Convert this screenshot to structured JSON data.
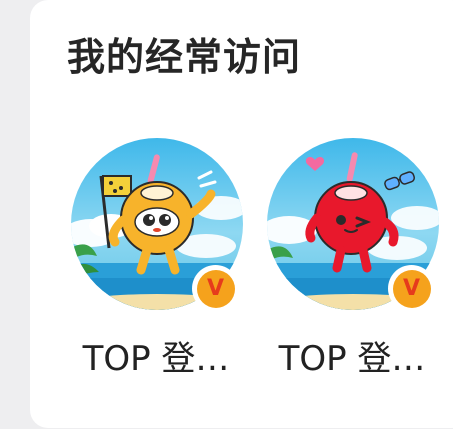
{
  "section": {
    "title": "我的经常访问"
  },
  "items": [
    {
      "name": "TOP 登…",
      "avatar_icon": "orange-coconut-mascot-icon",
      "badge_letter": "V",
      "badge_color": "#f5a21c"
    },
    {
      "name": "TOP 登…",
      "avatar_icon": "red-coconut-mascot-icon",
      "badge_letter": "V",
      "badge_color": "#f5a21c"
    }
  ],
  "colors": {
    "page_background": "#eeeef0",
    "card_background": "#ffffff",
    "title_text": "#262626",
    "item_text": "#222222"
  }
}
